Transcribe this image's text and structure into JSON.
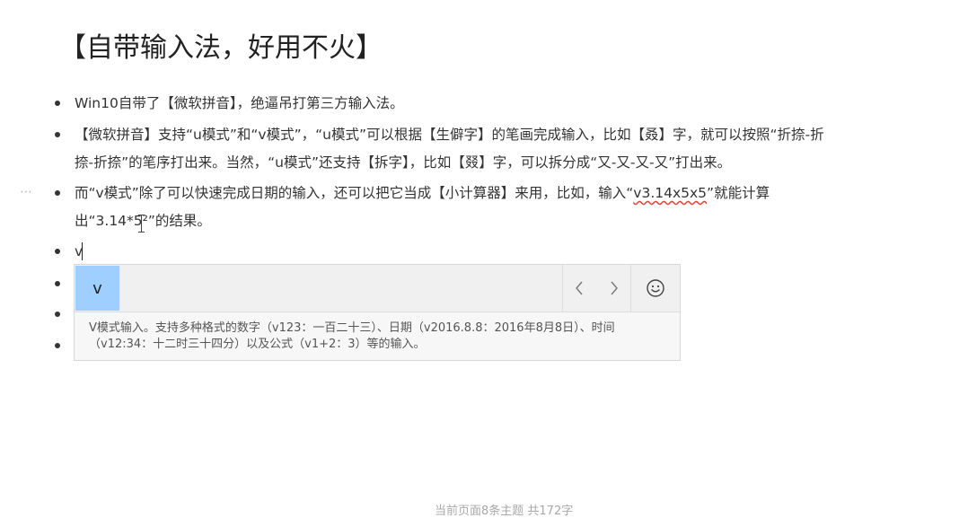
{
  "document": {
    "title": "【自带输入法，好用不火】",
    "items": [
      {
        "text": "Win10自带了【微软拼音】，绝逼吊打第三方输入法。"
      },
      {
        "line1": "【微软拼音】支持“u模式”和“v模式”，“u模式”可以根据【生僻字】的笔画完成输入，比如【叒】字，就可以按照“折捺-折",
        "line2": "捺-折捺”的笔序打出来。当然，“u模式”还支持【拆字】，比如【叕】字，可以拆分成“又-又-又-又”打出来。"
      },
      {
        "line1_before": "而“v模式”除了可以快速完成日期的输入，还可以把它当成【小计算器】来用，比如，输入“",
        "line1_underlined": "v3.14x5x5",
        "line1_after": "”就能计算",
        "line2": "出“3.14*5²”的结果。"
      },
      {
        "text": "v"
      }
    ],
    "more_handle": "⋯"
  },
  "ime": {
    "candidate": "v",
    "prev_label": "<",
    "next_label": ">",
    "emoji_icon": "smiley-icon",
    "description": "V模式输入。支持多种格式的数字（v123：一百二十三）、日期（v2016.8.8：2016年8月8日）、时间（v12:34：十二时三十四分）以及公式（v1+2：3）等的输入。"
  },
  "status_bar": {
    "text": "当前页面8条主题 共172字"
  },
  "colors": {
    "candidate_highlight": "#9fcfff",
    "spell_underline": "#e0463a"
  }
}
